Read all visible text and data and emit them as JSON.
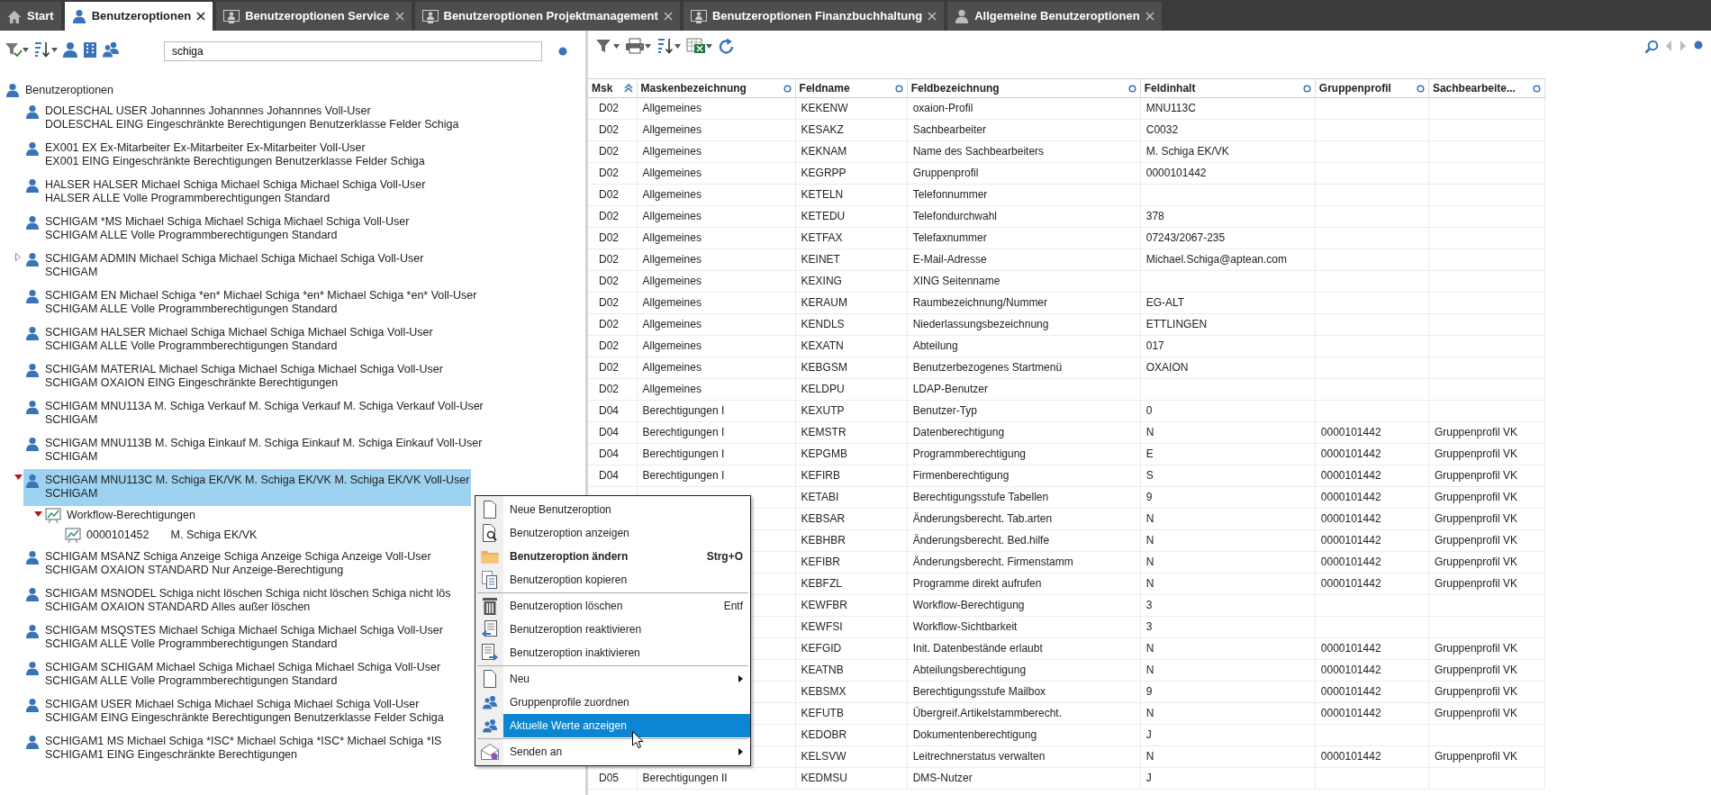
{
  "tabs": [
    {
      "label": "Start",
      "selected": false,
      "closable": false
    },
    {
      "label": "Benutzeroptionen",
      "selected": true,
      "closable": true
    },
    {
      "label": "Benutzeroptionen Service",
      "selected": false,
      "closable": true
    },
    {
      "label": "Benutzeroptionen Projektmanagement",
      "selected": false,
      "closable": true
    },
    {
      "label": "Benutzeroptionen Finanzbuchhaltung",
      "selected": false,
      "closable": true
    },
    {
      "label": "Allgemeine Benutzeroptionen",
      "selected": false,
      "closable": true
    }
  ],
  "left_panel": {
    "search": {
      "value": "schiga"
    },
    "tree": {
      "label": "Benutzeroptionen",
      "kind": "user",
      "selected": false,
      "children": [
        {
          "kind": "user",
          "line1": "DOLESCHAL USER Johannnes Johannnes Johannnes Voll-User",
          "line2": "DOLESCHAL EING Eingeschränkte Berechtigungen Benutzerklasse Felder Schiga",
          "selected": false
        },
        {
          "kind": "user",
          "line1": "EX001 EX Ex-Mitarbeiter Ex-Mitarbeiter Ex-Mitarbeiter Voll-User",
          "line2": "EX001 EING Eingeschränkte Berechtigungen Benutzerklasse Felder Schiga",
          "selected": false
        },
        {
          "kind": "user",
          "line1": "HALSER HALSER Michael Schiga Michael Schiga Michael Schiga Voll-User",
          "line2": "HALSER ALLE Volle Programmberechtigungen Standard",
          "selected": false
        },
        {
          "kind": "user",
          "line1": "SCHIGAM *MS Michael Schiga Michael Schiga Michael Schiga Voll-User",
          "line2": "SCHIGAM ALLE Volle Programmberechtigungen Standard",
          "selected": false
        },
        {
          "kind": "user",
          "line1": "SCHIGAM ADMIN Michael Schiga Michael Schiga Michael Schiga Voll-User",
          "line2": "SCHIGAM",
          "selected": false,
          "expanded": false
        },
        {
          "kind": "user",
          "line1": "SCHIGAM EN Michael Schiga *en* Michael Schiga *en* Michael Schiga *en* Voll-User",
          "line2": "SCHIGAM ALLE Volle Programmberechtigungen Standard",
          "selected": false
        },
        {
          "kind": "user",
          "line1": "SCHIGAM HALSER Michael Schiga Michael Schiga Michael Schiga Voll-User",
          "line2": "SCHIGAM ALLE Volle Programmberechtigungen Standard",
          "selected": false
        },
        {
          "kind": "user",
          "line1": "SCHIGAM MATERIAL Michael Schiga Michael Schiga Michael Schiga Voll-User",
          "line2": "SCHIGAM OXAION EING Eingeschränkte Berechtigungen",
          "selected": false
        },
        {
          "kind": "user",
          "line1": "SCHIGAM MNU113A M. Schiga Verkauf M. Schiga Verkauf M. Schiga Verkauf Voll-User",
          "line2": "SCHIGAM",
          "selected": false
        },
        {
          "kind": "user",
          "line1": "SCHIGAM MNU113B M. Schiga Einkauf M. Schiga Einkauf M. Schiga Einkauf Voll-User",
          "line2": "SCHIGAM",
          "selected": false
        },
        {
          "kind": "user",
          "line1": "SCHIGAM MNU113C M. Schiga EK/VK M. Schiga EK/VK M. Schiga EK/VK Voll-User",
          "line2": "SCHIGAM",
          "selected": true,
          "expanded": true,
          "children": [
            {
              "kind": "workflow",
              "label": "Workflow-Berechtigungen",
              "selected": false,
              "expanded": true,
              "children": [
                {
                  "kind": "workflow",
                  "code": "0000101452",
                  "label": "M. Schiga EK/VK",
                  "selected": false
                }
              ]
            }
          ]
        },
        {
          "kind": "user",
          "line1": "SCHIGAM MSANZ Schiga Anzeige Schiga Anzeige Schiga Anzeige Voll-User",
          "line2": "SCHIGAM OXAION STANDARD Nur Anzeige-Berechtigung",
          "selected": false
        },
        {
          "kind": "user",
          "line1": "SCHIGAM MSNODEL Schiga nicht löschen Schiga nicht löschen Schiga nicht lös",
          "line2": "SCHIGAM OXAION STANDARD Alles außer löschen",
          "selected": false
        },
        {
          "kind": "user",
          "line1": "SCHIGAM MSQSTES Michael Schiga Michael Schiga Michael Schiga Voll-User",
          "line2": "SCHIGAM ALLE Volle Programmberechtigungen Standard",
          "selected": false
        },
        {
          "kind": "user",
          "line1": "SCHIGAM SCHIGAM Michael Schiga Michael Schiga Michael Schiga Voll-User",
          "line2": "SCHIGAM ALLE Volle Programmberechtigungen Standard",
          "selected": false
        },
        {
          "kind": "user",
          "line1": "SCHIGAM USER Michael Schiga Michael Schiga Michael Schiga Voll-User",
          "line2": "SCHIGAM EING Eingeschränkte Berechtigungen Benutzerklasse Felder Schiga",
          "selected": false
        },
        {
          "kind": "user",
          "line1": "SCHIGAM1 MS Michael Schiga *ISC* Michael Schiga *ISC* Michael Schiga *IS",
          "line2": "SCHIGAM1 EING Eingeschränkte Berechtigungen",
          "selected": false
        }
      ]
    }
  },
  "table": {
    "columns": [
      {
        "label": "Msk",
        "sorted_ascending": true
      },
      {
        "label": "Maskenbezeichnung",
        "sorted_ascending": false
      },
      {
        "label": "Feldname",
        "sorted_ascending": false
      },
      {
        "label": "Feldbezeichnung",
        "sorted_ascending": false
      },
      {
        "label": "Feldinhalt",
        "sorted_ascending": false
      },
      {
        "label": "Gruppenprofil",
        "sorted_ascending": false
      },
      {
        "label": "Sachbearbeite...",
        "sorted_ascending": false
      }
    ],
    "rows": [
      [
        "D02",
        "Allgemeines",
        "KEKENW",
        "oxaion-Profil",
        "MNU113C",
        "",
        ""
      ],
      [
        "D02",
        "Allgemeines",
        "KESAKZ",
        "Sachbearbeiter",
        "C0032",
        "",
        ""
      ],
      [
        "D02",
        "Allgemeines",
        "KEKNAM",
        "Name des Sachbearbeiters",
        "M. Schiga EK/VK",
        "",
        ""
      ],
      [
        "D02",
        "Allgemeines",
        "KEGRPP",
        "Gruppenprofil",
        "0000101442",
        "",
        ""
      ],
      [
        "D02",
        "Allgemeines",
        "KETELN",
        "Telefonnummer",
        "",
        "",
        ""
      ],
      [
        "D02",
        "Allgemeines",
        "KETEDU",
        "Telefondurchwahl",
        "378",
        "",
        ""
      ],
      [
        "D02",
        "Allgemeines",
        "KETFAX",
        "Telefaxnummer",
        "07243/2067-235",
        "",
        ""
      ],
      [
        "D02",
        "Allgemeines",
        "KEINET",
        "E-Mail-Adresse",
        "Michael.Schiga@aptean.com",
        "",
        ""
      ],
      [
        "D02",
        "Allgemeines",
        "KEXING",
        "XING Seitenname",
        "",
        "",
        ""
      ],
      [
        "D02",
        "Allgemeines",
        "KERAUM",
        "Raumbezeichnung/Nummer",
        "EG-ALT",
        "",
        ""
      ],
      [
        "D02",
        "Allgemeines",
        "KENDLS",
        "Niederlassungsbezeichnung",
        "ETTLINGEN",
        "",
        ""
      ],
      [
        "D02",
        "Allgemeines",
        "KEXATN",
        "Abteilung",
        "017",
        "",
        ""
      ],
      [
        "D02",
        "Allgemeines",
        "KEBGSM",
        "Benutzerbezogenes Startmenü",
        "OXAION",
        "",
        ""
      ],
      [
        "D02",
        "Allgemeines",
        "KELDPU",
        "LDAP-Benutzer",
        "",
        "",
        ""
      ],
      [
        "D04",
        "Berechtigungen I",
        "KEXUTP",
        "Benutzer-Typ",
        "0",
        "",
        ""
      ],
      [
        "D04",
        "Berechtigungen I",
        "KEMSTR",
        "Datenberechtigung",
        "N",
        "0000101442",
        "Gruppenprofil VK"
      ],
      [
        "D04",
        "Berechtigungen I",
        "KEPGMB",
        "Programmberechtigung",
        "E",
        "0000101442",
        "Gruppenprofil VK"
      ],
      [
        "D04",
        "Berechtigungen I",
        "KEFIRB",
        "Firmenberechtigung",
        "S",
        "0000101442",
        "Gruppenprofil VK"
      ],
      [
        "",
        "",
        "KETABI",
        "Berechtigungsstufe Tabellen",
        "9",
        "0000101442",
        "Gruppenprofil VK"
      ],
      [
        "",
        "",
        "KEBSAR",
        "Änderungsberecht. Tab.arten",
        "N",
        "0000101442",
        "Gruppenprofil VK"
      ],
      [
        "",
        "",
        "KEBHBR",
        "Änderungsberecht. Bed.hilfe",
        "N",
        "0000101442",
        "Gruppenprofil VK"
      ],
      [
        "",
        "",
        "KEFIBR",
        "Änderungsberecht. Firmenstamm",
        "N",
        "0000101442",
        "Gruppenprofil VK"
      ],
      [
        "",
        "",
        "KEBFZL",
        "Programme direkt aufrufen",
        "N",
        "0000101442",
        "Gruppenprofil VK"
      ],
      [
        "",
        "",
        "KEWFBR",
        "Workflow-Berechtigung",
        "3",
        "",
        ""
      ],
      [
        "",
        "",
        "KEWFSI",
        "Workflow-Sichtbarkeit",
        "3",
        "",
        ""
      ],
      [
        "",
        "",
        "KEFGID",
        "Init. Datenbestände erlaubt",
        "N",
        "0000101442",
        "Gruppenprofil VK"
      ],
      [
        "",
        "",
        "KEATNB",
        "Abteilungsberechtigung",
        "N",
        "0000101442",
        "Gruppenprofil VK"
      ],
      [
        "",
        "",
        "KEBSMX",
        "Berechtigungsstufe Mailbox",
        "9",
        "0000101442",
        "Gruppenprofil VK"
      ],
      [
        "",
        "",
        "KEFUTB",
        "Übergreif.Artikelstammberecht.",
        "N",
        "0000101442",
        "Gruppenprofil VK"
      ],
      [
        "",
        "",
        "KEDOBR",
        "Dokumentenberechtigung",
        "J",
        "",
        ""
      ],
      [
        "",
        "",
        "KELSVW",
        "Leitrechnerstatus verwalten",
        "N",
        "0000101442",
        "Gruppenprofil VK"
      ],
      [
        "D05",
        "Berechtigungen II",
        "KEDMSU",
        "DMS-Nutzer",
        "J",
        "",
        ""
      ]
    ]
  },
  "context_menu": {
    "groups": [
      [
        {
          "label": "Neue Benutzeroption",
          "default": false,
          "submenu": false,
          "selected": false
        },
        {
          "label": "Benutzeroption anzeigen",
          "default": false,
          "submenu": false,
          "selected": false
        },
        {
          "label": "Benutzeroption ändern",
          "shortcut": "Strg+O",
          "default": true,
          "submenu": false,
          "selected": false
        },
        {
          "label": "Benutzeroption kopieren",
          "default": false,
          "submenu": false,
          "selected": false
        }
      ],
      [
        {
          "label": "Benutzeroption löschen",
          "shortcut": "Entf",
          "default": false,
          "submenu": false,
          "selected": false
        },
        {
          "label": "Benutzeroption reaktivieren",
          "default": false,
          "submenu": false,
          "selected": false
        },
        {
          "label": "Benutzeroption inaktivieren",
          "default": false,
          "submenu": false,
          "selected": false
        }
      ],
      [
        {
          "label": "Neu",
          "default": false,
          "submenu": true,
          "selected": false
        },
        {
          "label": "Gruppenprofile zuordnen",
          "default": false,
          "submenu": false,
          "selected": false
        },
        {
          "label": "Aktuelle Werte anzeigen",
          "default": false,
          "submenu": false,
          "selected": true
        }
      ],
      [
        {
          "label": "Senden an",
          "default": false,
          "submenu": true,
          "selected": false
        }
      ]
    ]
  }
}
